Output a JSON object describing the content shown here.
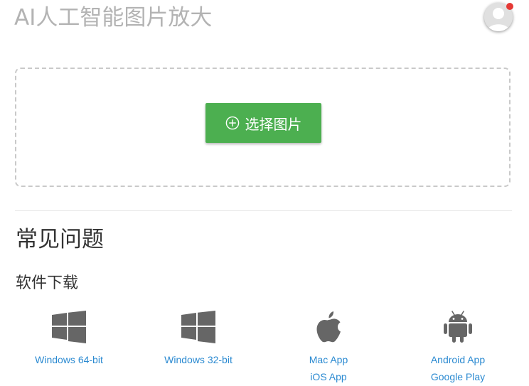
{
  "header": {
    "title": "AI人工智能图片放大",
    "avatar_icon": "user-avatar-icon",
    "notification_color": "#e53935"
  },
  "upload": {
    "button_label": "选择图片",
    "button_icon": "plus-circle-icon",
    "button_color": "#4caf50"
  },
  "faq": {
    "title": "常见问题"
  },
  "downloads": {
    "title": "软件下载",
    "link_color": "#2b8ad1",
    "platforms": [
      {
        "icon": "windows-icon",
        "links": [
          "Windows 64-bit"
        ]
      },
      {
        "icon": "windows-icon",
        "links": [
          "Windows 32-bit"
        ]
      },
      {
        "icon": "apple-icon",
        "links": [
          "Mac App",
          "iOS App"
        ]
      },
      {
        "icon": "android-icon",
        "links": [
          "Android App",
          "Google Play"
        ]
      }
    ]
  }
}
